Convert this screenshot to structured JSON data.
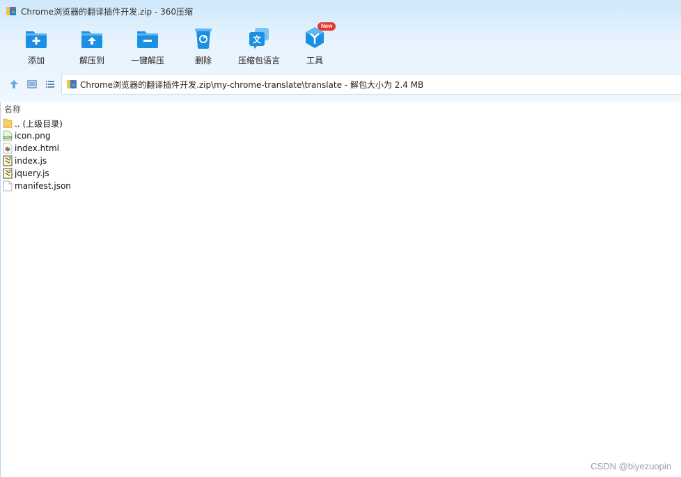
{
  "window": {
    "title": "Chrome浏览器的翻译插件开发.zip - 360压缩"
  },
  "toolbar": {
    "items": [
      {
        "label": "添加",
        "icon": "folder-add-icon"
      },
      {
        "label": "解压到",
        "icon": "folder-extract-icon"
      },
      {
        "label": "一键解压",
        "icon": "folder-oneclick-icon"
      },
      {
        "label": "删除",
        "icon": "trash-icon"
      },
      {
        "label": "压缩包语言",
        "icon": "language-icon"
      },
      {
        "label": "工具",
        "icon": "tools-icon",
        "badge": "New"
      }
    ]
  },
  "address": {
    "path": "Chrome浏览器的翻译插件开发.zip\\my-chrome-translate\\translate - 解包大小为 2.4 MB"
  },
  "list": {
    "column_name": "名称",
    "files": [
      {
        "name": ".. (上级目录)",
        "type": "parent-folder"
      },
      {
        "name": "icon.png",
        "type": "png"
      },
      {
        "name": "index.html",
        "type": "html"
      },
      {
        "name": "index.js",
        "type": "js"
      },
      {
        "name": "jquery.js",
        "type": "js"
      },
      {
        "name": "manifest.json",
        "type": "json"
      }
    ]
  },
  "watermark": "CSDN @biyezuopin",
  "colors": {
    "accent": "#1a8fe3",
    "badge": "#e4392a"
  }
}
